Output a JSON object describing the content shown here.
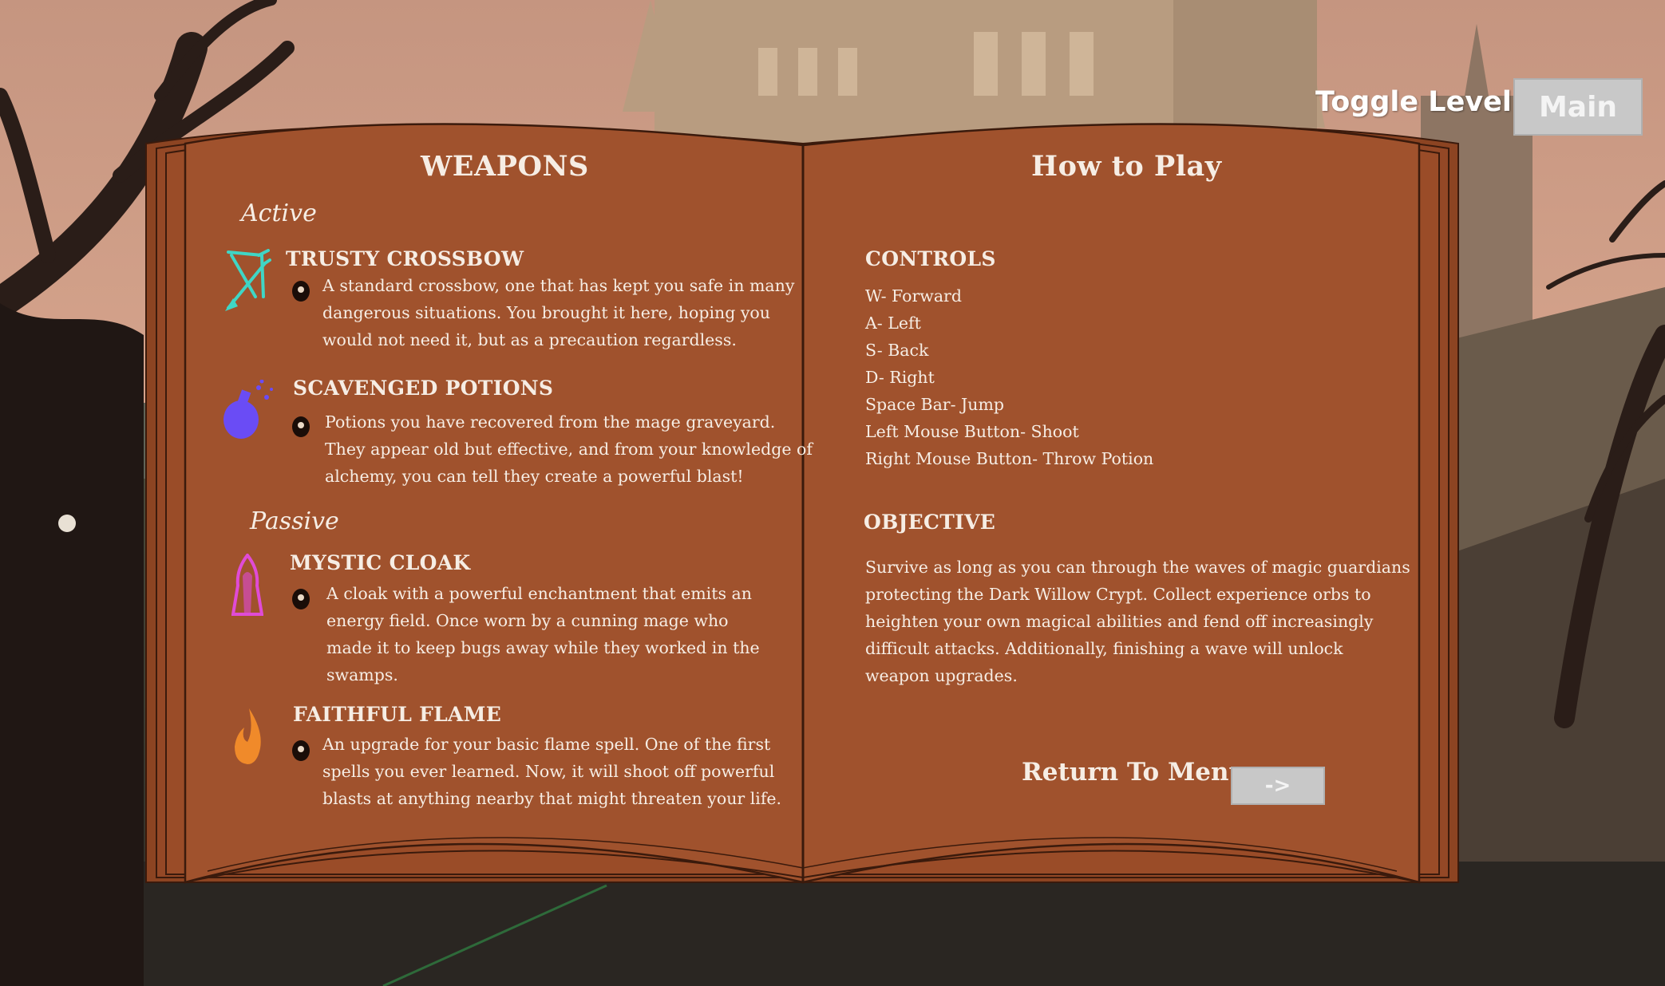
{
  "toggle": {
    "label": "Toggle Level:",
    "value": "Main"
  },
  "weapons_page": {
    "title": "WEAPONS",
    "active_label": "Active",
    "passive_label": "Passive",
    "items": [
      {
        "name": "TRUSTY CROSSBOW",
        "icon": "crossbow-icon",
        "lines": [
          "A standard crossbow, one that has kept you safe in many",
          "dangerous situations. You brought it here, hoping you",
          "would not need it, but as a precaution regardless."
        ]
      },
      {
        "name": "SCAVENGED POTIONS",
        "icon": "potion-icon",
        "lines": [
          "Potions you have recovered from the mage graveyard.",
          "They appear old but effective, and from your knowledge of",
          "alchemy, you can tell they create a powerful blast!"
        ]
      },
      {
        "name": "MYSTIC CLOAK",
        "icon": "cloak-icon",
        "lines": [
          "A cloak with a powerful enchantment that emits an",
          "energy field. Once worn by a cunning mage who",
          "made it to keep bugs away while they worked in the",
          "swamps."
        ]
      },
      {
        "name": "FAITHFUL FLAME",
        "icon": "flame-icon",
        "lines": [
          "An upgrade for your basic flame spell. One of the first",
          "spells you ever learned. Now, it will shoot off powerful",
          "blasts at anything nearby that might threaten your life."
        ]
      }
    ]
  },
  "howto_page": {
    "title": "How to Play",
    "controls_title": "CONTROLS",
    "controls": [
      "W- Forward",
      "A- Left",
      "S- Back",
      "D- Right",
      "Space Bar- Jump",
      "Left Mouse Button- Shoot",
      "Right Mouse Button- Throw Potion"
    ],
    "objective_title": "OBJECTIVE",
    "objective_lines": [
      "Survive as long as you can through the waves of magic guardians",
      "protecting the Dark Willow Crypt.  Collect experience orbs to",
      "heighten your own magical abilities and fend off increasingly",
      "difficult attacks. Additionally, finishing a wave will unlock",
      "weapon upgrades."
    ],
    "return_label": "Return To Menu",
    "return_button": "->"
  },
  "colors": {
    "page": "#a0522d",
    "page_edge": "#8c4422",
    "text": "#f6ede4",
    "crossbow": "#3fd6c6",
    "potion": "#6a4cf5",
    "cloak": "#e04bd6",
    "flame": "#f08a2a",
    "button": "#c8c8c8"
  }
}
